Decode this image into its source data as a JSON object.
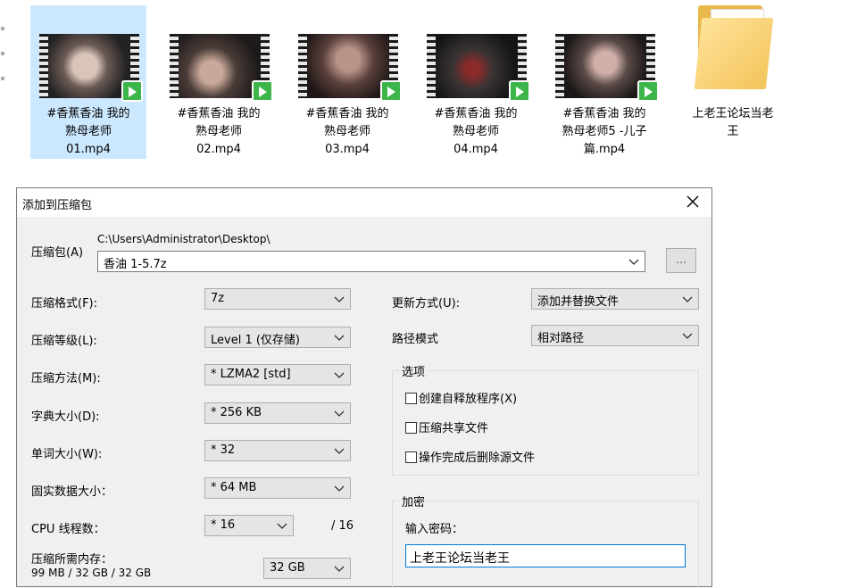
{
  "explorer": {
    "files": [
      {
        "name": "#香蕉香油  我的\n熟母老师\n01.mp4",
        "thumb_color": "#6b5a55"
      },
      {
        "name": "#香蕉香油  我的\n熟母老师\n02.mp4",
        "thumb_color": "#4a3c38"
      },
      {
        "name": "#香蕉香油  我的\n熟母老师\n03.mp4",
        "thumb_color": "#5a403c"
      },
      {
        "name": "#香蕉香油  我的\n熟母老师\n04.mp4",
        "thumb_color": "#3a3434"
      },
      {
        "name": "#香蕉香油  我的\n熟母老师5 -儿子\n篇.mp4",
        "thumb_color": "#5a4a48"
      }
    ],
    "folder": {
      "name": "上老王论坛当老\n王"
    }
  },
  "dialog": {
    "title": "添加到压缩包",
    "archive_label": "压缩包(A)",
    "archive_path": "C:\\Users\\Administrator\\Desktop\\",
    "archive_name": "香油 1-5.7z",
    "browse_label": "...",
    "format_label": "压缩格式(F):",
    "format_value": "7z",
    "level_label": "压缩等级(L):",
    "level_value": "Level 1 (仅存储)",
    "method_label": "压缩方法(M):",
    "method_value": "*  LZMA2 [std]",
    "dict_label": "字典大小(D):",
    "dict_value": "*  256 KB",
    "word_label": "单词大小(W):",
    "word_value": "*  32",
    "solid_label": "固实数据大小：",
    "solid_value": "*  64 MB",
    "cpu_label": "CPU 线程数：",
    "cpu_value": "*  16",
    "cpu_total": "/ 16",
    "mem_label": "压缩所需内存：",
    "mem_detail": "99 MB / 32 GB / 32 GB",
    "mem_value": "32 GB",
    "update_label": "更新方式(U):",
    "update_value": "添加并替换文件",
    "path_label": "路径模式",
    "path_value": "相对路径",
    "options_title": "选项",
    "opt_sfx": "创建自释放程序(X)",
    "opt_shared": "压缩共享文件",
    "opt_delete": "操作完成后删除源文件",
    "encrypt_title": "加密",
    "password_label": "输入密码：",
    "password_value": "上老王论坛当老王"
  },
  "colors": {
    "selection": "#cce8ff",
    "accent_border": "#0078d7",
    "dialog_bg": "#f0f0f0",
    "badge": "#3cb54a"
  }
}
